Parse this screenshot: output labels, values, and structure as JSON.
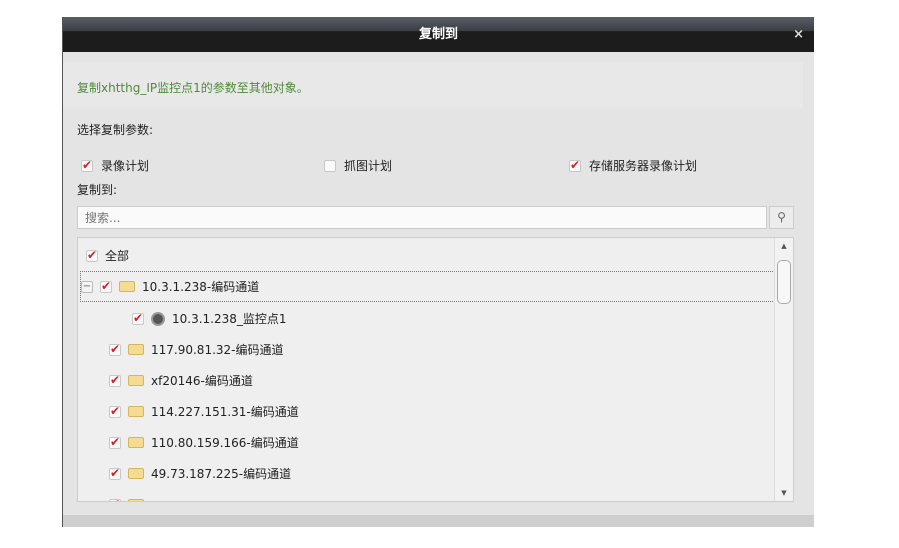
{
  "dialog": {
    "title": "复制到",
    "close": "×"
  },
  "message": "复制xhtthg_IP监控点1的参数至其他对象。",
  "params_label": "选择复制参数:",
  "options": [
    {
      "label": "录像计划",
      "checked": true
    },
    {
      "label": "抓图计划",
      "checked": false
    },
    {
      "label": "存储服务器录像计划",
      "checked": true
    }
  ],
  "copy_to_label": "复制到:",
  "search": {
    "placeholder": "搜索..."
  },
  "tree": {
    "all_label": "全部",
    "items": [
      {
        "label": "10.3.1.238-编码通道",
        "type": "folder",
        "expanded": true,
        "checked": true
      },
      {
        "label": "10.3.1.238_监控点1",
        "type": "camera",
        "checked": true
      },
      {
        "label": "117.90.81.32-编码通道",
        "type": "folder",
        "checked": true
      },
      {
        "label": "xf20146-编码通道",
        "type": "folder",
        "checked": true
      },
      {
        "label": "114.227.151.31-编码通道",
        "type": "folder",
        "checked": true
      },
      {
        "label": "110.80.159.166-编码通道",
        "type": "folder",
        "checked": true
      },
      {
        "label": "49.73.187.225-编码通道",
        "type": "folder",
        "checked": true
      }
    ]
  }
}
